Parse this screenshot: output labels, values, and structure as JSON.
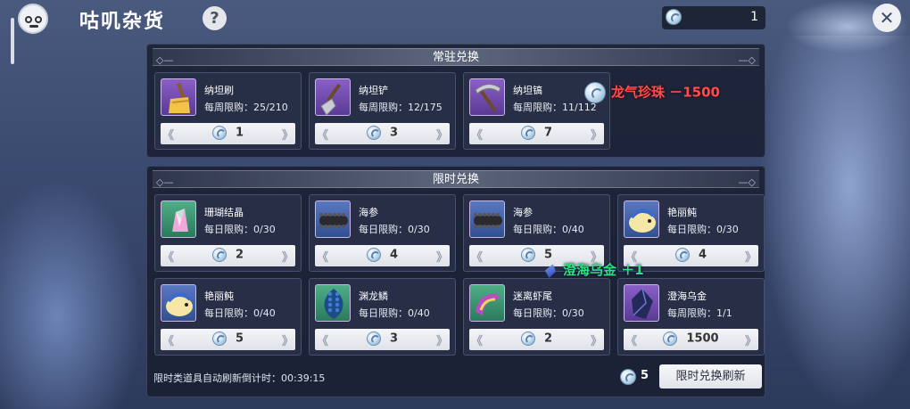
{
  "header": {
    "title": "咕叽杂货",
    "help_label": "?",
    "currency_count": "1",
    "close_label": "✕"
  },
  "permanent": {
    "heading": "常驻兑换",
    "items": [
      {
        "name": "纳坦刷",
        "limit": "每周限购：25/210",
        "price": "1",
        "icon": "brush-icon",
        "bg": "purple"
      },
      {
        "name": "纳坦铲",
        "limit": "每周限购：12/175",
        "price": "3",
        "icon": "shovel-icon",
        "bg": "purple"
      },
      {
        "name": "纳坦镐",
        "limit": "每周限购：11/112",
        "price": "7",
        "icon": "pickaxe-icon",
        "bg": "purple"
      }
    ]
  },
  "limited": {
    "heading": "限时兑换",
    "items": [
      {
        "name": "珊瑚结晶",
        "limit": "每日限购：0/30",
        "price": "2",
        "icon": "coral-crystal-icon",
        "bg": "green"
      },
      {
        "name": "海参",
        "limit": "每日限购：0/30",
        "price": "4",
        "icon": "sea-cucumber-icon",
        "bg": "blue"
      },
      {
        "name": "海参",
        "limit": "每日限购：0/40",
        "price": "5",
        "icon": "sea-cucumber-icon",
        "bg": "blue"
      },
      {
        "name": "艳丽鲀",
        "limit": "每日限购：0/30",
        "price": "4",
        "icon": "pufferfish-icon",
        "bg": "blue"
      },
      {
        "name": "艳丽鲀",
        "limit": "每日限购：0/40",
        "price": "5",
        "icon": "pufferfish-icon",
        "bg": "blue"
      },
      {
        "name": "渊龙鳞",
        "limit": "每日限购：0/40",
        "price": "3",
        "icon": "dragon-scale-icon",
        "bg": "green"
      },
      {
        "name": "迷离虾尾",
        "limit": "每日限购：0/30",
        "price": "2",
        "icon": "shrimp-tail-icon",
        "bg": "green"
      },
      {
        "name": "澄海乌金",
        "limit": "每周限购：1/1",
        "price": "1500",
        "icon": "dark-gold-gem-icon",
        "bg": "purple"
      }
    ]
  },
  "footer": {
    "countdown": "限时类道具自动刷新倒计时：00:39:15",
    "refresh_cost": "5",
    "refresh_label": "限时兑换刷新"
  },
  "floaters": {
    "spent": "龙气珍珠 －1500",
    "gained": "澄海乌金 ＋1"
  },
  "colors": {
    "spent": "#ff4c4c",
    "gained": "#2fe07a",
    "accent": "#8a5fc7"
  }
}
